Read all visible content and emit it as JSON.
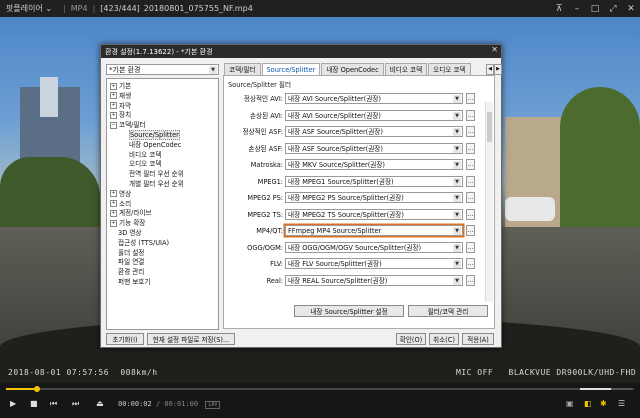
{
  "player": {
    "app_name": "팟플레이어",
    "format": "MP4",
    "playlist_pos": "[423/444]",
    "filename": "20180801_075755_NF.mp4"
  },
  "osd": {
    "timestamp": "2018-08-01 07:57:56",
    "speed": "008km/h",
    "mic": "MIC OFF",
    "device": "BLACKVUE DR900LK/UHD-FHD"
  },
  "dialog": {
    "title": "환경 설정(1.7.13622) - *기본 환경",
    "close": "✕",
    "profile": "*기본 환경",
    "tree": [
      {
        "label": "기본",
        "level": 0,
        "expand": "+"
      },
      {
        "label": "재생",
        "level": 0,
        "expand": "+"
      },
      {
        "label": "자막",
        "level": 0,
        "expand": "+"
      },
      {
        "label": "장치",
        "level": 0,
        "expand": "+"
      },
      {
        "label": "코덱/필터",
        "level": 0,
        "expand": "−"
      },
      {
        "label": "Source/Splitter",
        "level": 1,
        "expand": ""
      },
      {
        "label": "내장 OpenCodec",
        "level": 1,
        "expand": ""
      },
      {
        "label": "비디오 코덱",
        "level": 1,
        "expand": ""
      },
      {
        "label": "오디오 코덱",
        "level": 1,
        "expand": ""
      },
      {
        "label": "전역 필터 우선 순위",
        "level": 1,
        "expand": ""
      },
      {
        "label": "개별 필터 우선 순위",
        "level": 1,
        "expand": ""
      },
      {
        "label": "영상",
        "level": 0,
        "expand": "+"
      },
      {
        "label": "소리",
        "level": 0,
        "expand": "+"
      },
      {
        "label": "게정/라이브",
        "level": 0,
        "expand": "+"
      },
      {
        "label": "기능 확장",
        "level": 0,
        "expand": "+"
      },
      {
        "label": "3D 영상",
        "level": 0,
        "expand": ""
      },
      {
        "label": "접근성 (TTS/UIA)",
        "level": 0,
        "expand": ""
      },
      {
        "label": "풀더 설정",
        "level": 0,
        "expand": ""
      },
      {
        "label": "파일 연결",
        "level": 0,
        "expand": ""
      },
      {
        "label": "환경 관리",
        "level": 0,
        "expand": ""
      },
      {
        "label": "퍼맨 보호기",
        "level": 0,
        "expand": ""
      }
    ],
    "tabs": [
      "코덱/필터",
      "Source/Splitter",
      "내장 OpenCodec",
      "비디오 코덱",
      "오디오 코덱"
    ],
    "active_tab": 1,
    "group_title": "Source/Splitter 필터",
    "rows": [
      {
        "label": "정상적인 AVI:",
        "value": "내장 AVI Source/Splitter(권장)",
        "highlight": false
      },
      {
        "label": "손상된 AVI:",
        "value": "내장 AVI Source/Splitter(권장)",
        "highlight": false
      },
      {
        "label": "정상적인 ASF:",
        "value": "내장 ASF Source/Splitter(권장)",
        "highlight": false
      },
      {
        "label": "손상된 ASF:",
        "value": "내장 ASF Source/Splitter(권장)",
        "highlight": false
      },
      {
        "label": "Matroska:",
        "value": "내장 MKV Source/Splitter(권장)",
        "highlight": false
      },
      {
        "label": "MPEG1:",
        "value": "내장 MPEG1 Source/Splitter(권장)",
        "highlight": false
      },
      {
        "label": "MPEG2 PS:",
        "value": "내장 MPEG2 PS Source/Splitter(권장)",
        "highlight": false
      },
      {
        "label": "MPEG2 TS:",
        "value": "내장 MPEG2 TS Source/Splitter(권장)",
        "highlight": false
      },
      {
        "label": "MP4/QT:",
        "value": "FFmpeg MP4 Source/Splitter",
        "highlight": true
      },
      {
        "label": "OGG/OGM:",
        "value": "내장 OGG/OGM/OGV Source/Splitter(권장)",
        "highlight": false
      },
      {
        "label": "FLV:",
        "value": "내장 FLV Source/Splitter(권장)",
        "highlight": false
      },
      {
        "label": "Real:",
        "value": "내장 REAL Source/Splitter(권장)",
        "highlight": false
      }
    ],
    "dots_label": "...",
    "builtin_settings_btn": "내장 Source/Splitter 설정",
    "filter_manage_btn": "필터/코덱 관리",
    "reset_btn": "초기화(I)",
    "save_btn": "현재 설정 파일로 저장(S)...",
    "ok_btn": "확인(O)",
    "cancel_btn": "취소(C)",
    "apply_btn": "적용(A)"
  },
  "controls": {
    "current": "00:00:02",
    "duration": "/ 00:01:00",
    "badge": "LAV",
    "progress": 0.05,
    "volume": 0.6
  },
  "colors": {
    "accent": "#f3c300",
    "highlight": "#e07020",
    "link": "#0b59b4"
  }
}
